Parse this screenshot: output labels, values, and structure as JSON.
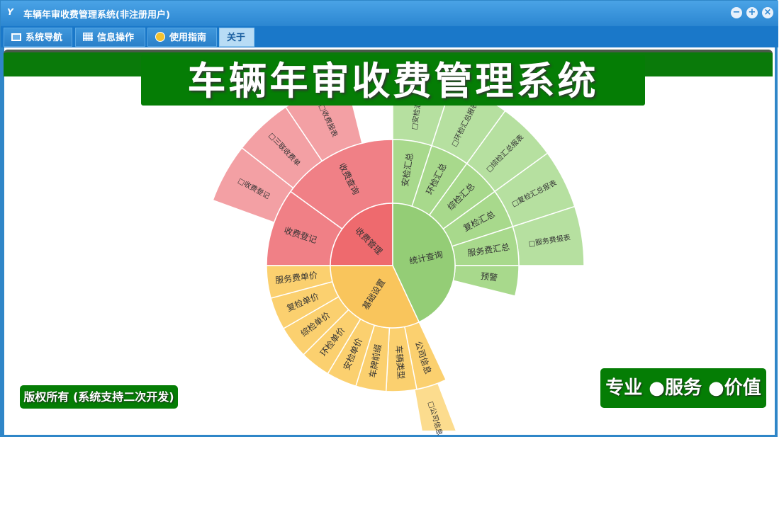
{
  "window": {
    "title": "车辆年审收费管理系统(非注册用户)",
    "logo": "Y",
    "buttons": {
      "minimize": "−",
      "maximize": "+",
      "close": "×"
    }
  },
  "menu": [
    {
      "label": "系统导航",
      "icon": "monitor-icon"
    },
    {
      "label": "信息操作",
      "icon": "grid-icon"
    },
    {
      "label": "使用指南",
      "icon": "help-icon"
    },
    {
      "label": "关于",
      "icon": ""
    }
  ],
  "main_title": "车辆年审收费管理系统",
  "copyright": "版权所有 (系统支持二次开发)",
  "slogan": "专业 ●服务 ●价值",
  "colors": {
    "green": "#057d05",
    "red_center": "#ee6a6e",
    "red_mid": "#f08086",
    "red_outer": "#f3a0a4",
    "green_center": "#94cd76",
    "green_mid": "#a8d98c",
    "green_outer": "#b6e0a0",
    "yellow_center": "#f9c55c",
    "yellow_mid": "#fbd06f",
    "yellow_outer": "#fcdc8e"
  },
  "sunburst": [
    {
      "label": "收费管理",
      "color": "red",
      "children": [
        {
          "label": "收费登记",
          "children": [
            "□收费登记",
            "□三联收费单"
          ]
        },
        {
          "label": "收费查询",
          "children": [
            "□收费报表"
          ]
        }
      ]
    },
    {
      "label": "统计查询",
      "color": "green",
      "children": [
        {
          "label": "安检汇总",
          "children": [
            "□安检汇总表"
          ]
        },
        {
          "label": "环检汇总",
          "children": [
            "□环检汇总报表"
          ]
        },
        {
          "label": "综检汇总",
          "children": [
            "□综检汇总报表"
          ]
        },
        {
          "label": "复检汇总",
          "children": [
            "□复检汇总报表"
          ]
        },
        {
          "label": "服务费汇总",
          "children": [
            "□服务费报表"
          ]
        },
        {
          "label": "预警",
          "children": []
        }
      ]
    },
    {
      "label": "基础设置",
      "color": "yellow",
      "children": [
        {
          "label": "公司信息",
          "children": [
            "□公司信息"
          ]
        },
        {
          "label": "车辆类型",
          "children": []
        },
        {
          "label": "车牌前缀",
          "children": []
        },
        {
          "label": "安检单价",
          "children": []
        },
        {
          "label": "环检单价",
          "children": []
        },
        {
          "label": "综检单价",
          "children": []
        },
        {
          "label": "复检单价",
          "children": []
        },
        {
          "label": "服务费单价",
          "children": []
        }
      ]
    }
  ]
}
